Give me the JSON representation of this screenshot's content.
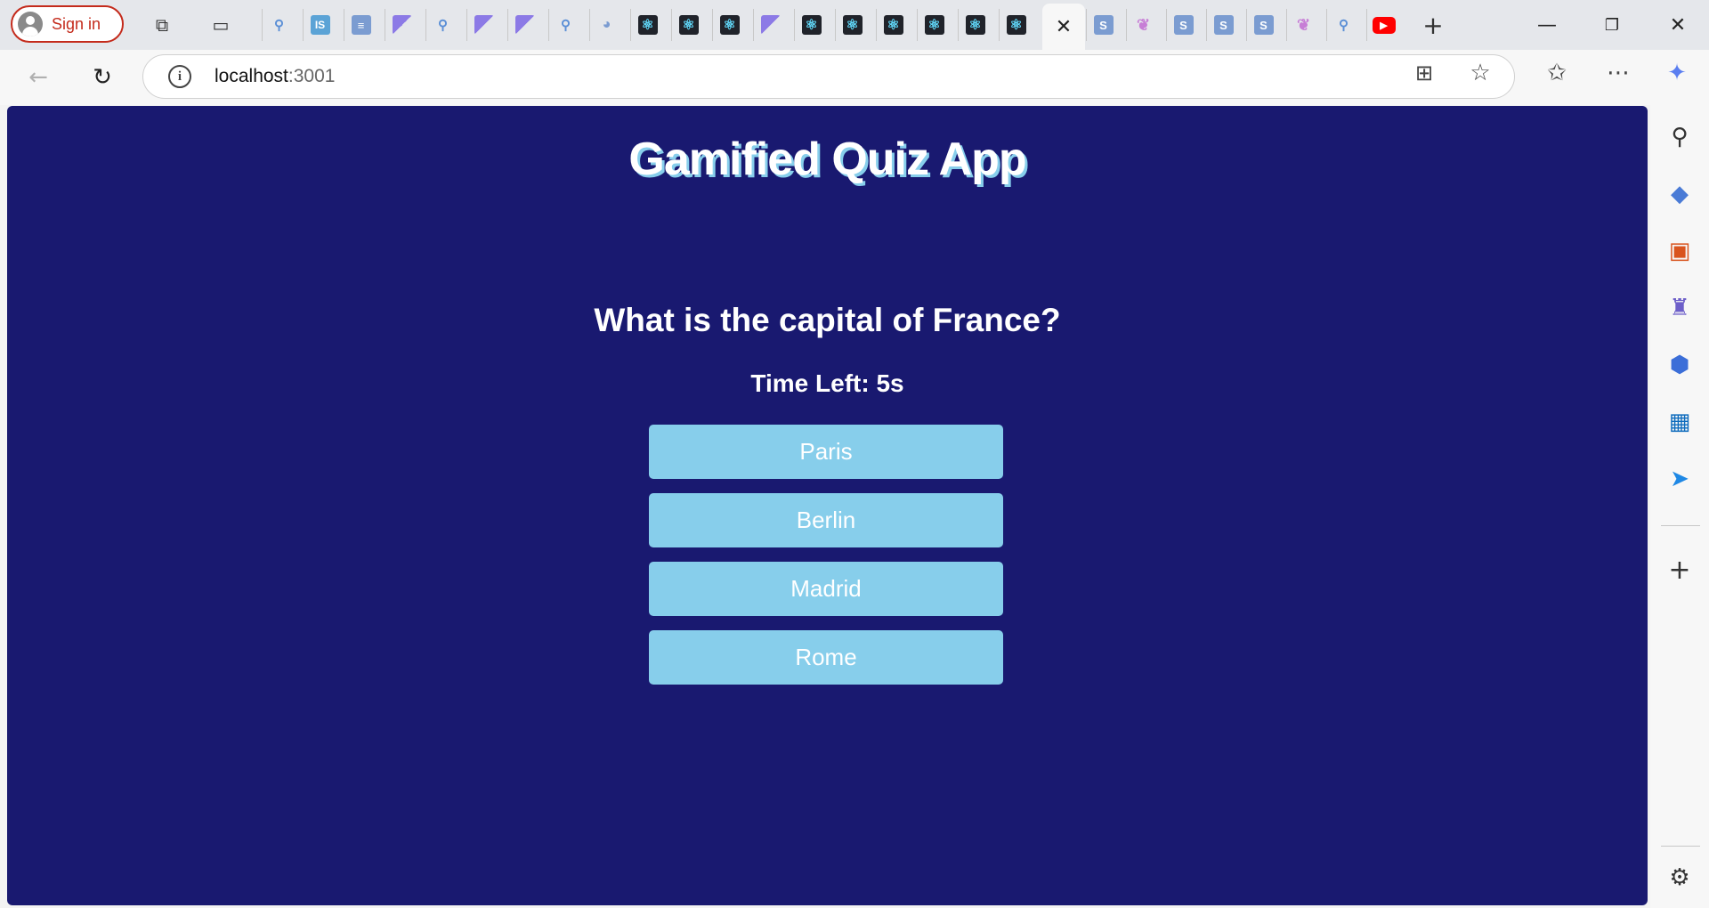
{
  "browser": {
    "signin_label": "Sign in",
    "tab_favicons": [
      "search",
      "is",
      "doc",
      "purple",
      "search",
      "purple",
      "purple",
      "search",
      "whale",
      "react",
      "react",
      "react",
      "purple",
      "react",
      "react",
      "react",
      "react",
      "react",
      "react"
    ],
    "tab_favicons_after": [
      "blue-s",
      "butterfly",
      "blue-s",
      "blue-s",
      "blue-s",
      "butterfly",
      "search",
      "yt"
    ],
    "url_host": "localhost",
    "url_port": ":3001"
  },
  "icons": {
    "new_tab": "plus-icon",
    "minimize": "minimize-icon",
    "restore": "restore-icon",
    "close": "close-icon"
  },
  "colors": {
    "page_background": "#191970",
    "button_background": "#87ceeb",
    "title_shadow": "#87ceeb",
    "text": "#ffffff",
    "signin_accent": "#c42b1c"
  },
  "quiz": {
    "title": "Gamified Quiz App",
    "question": "What is the capital of France?",
    "timer_text": "Time Left: 5s",
    "options": [
      "Paris",
      "Berlin",
      "Madrid",
      "Rome"
    ]
  }
}
